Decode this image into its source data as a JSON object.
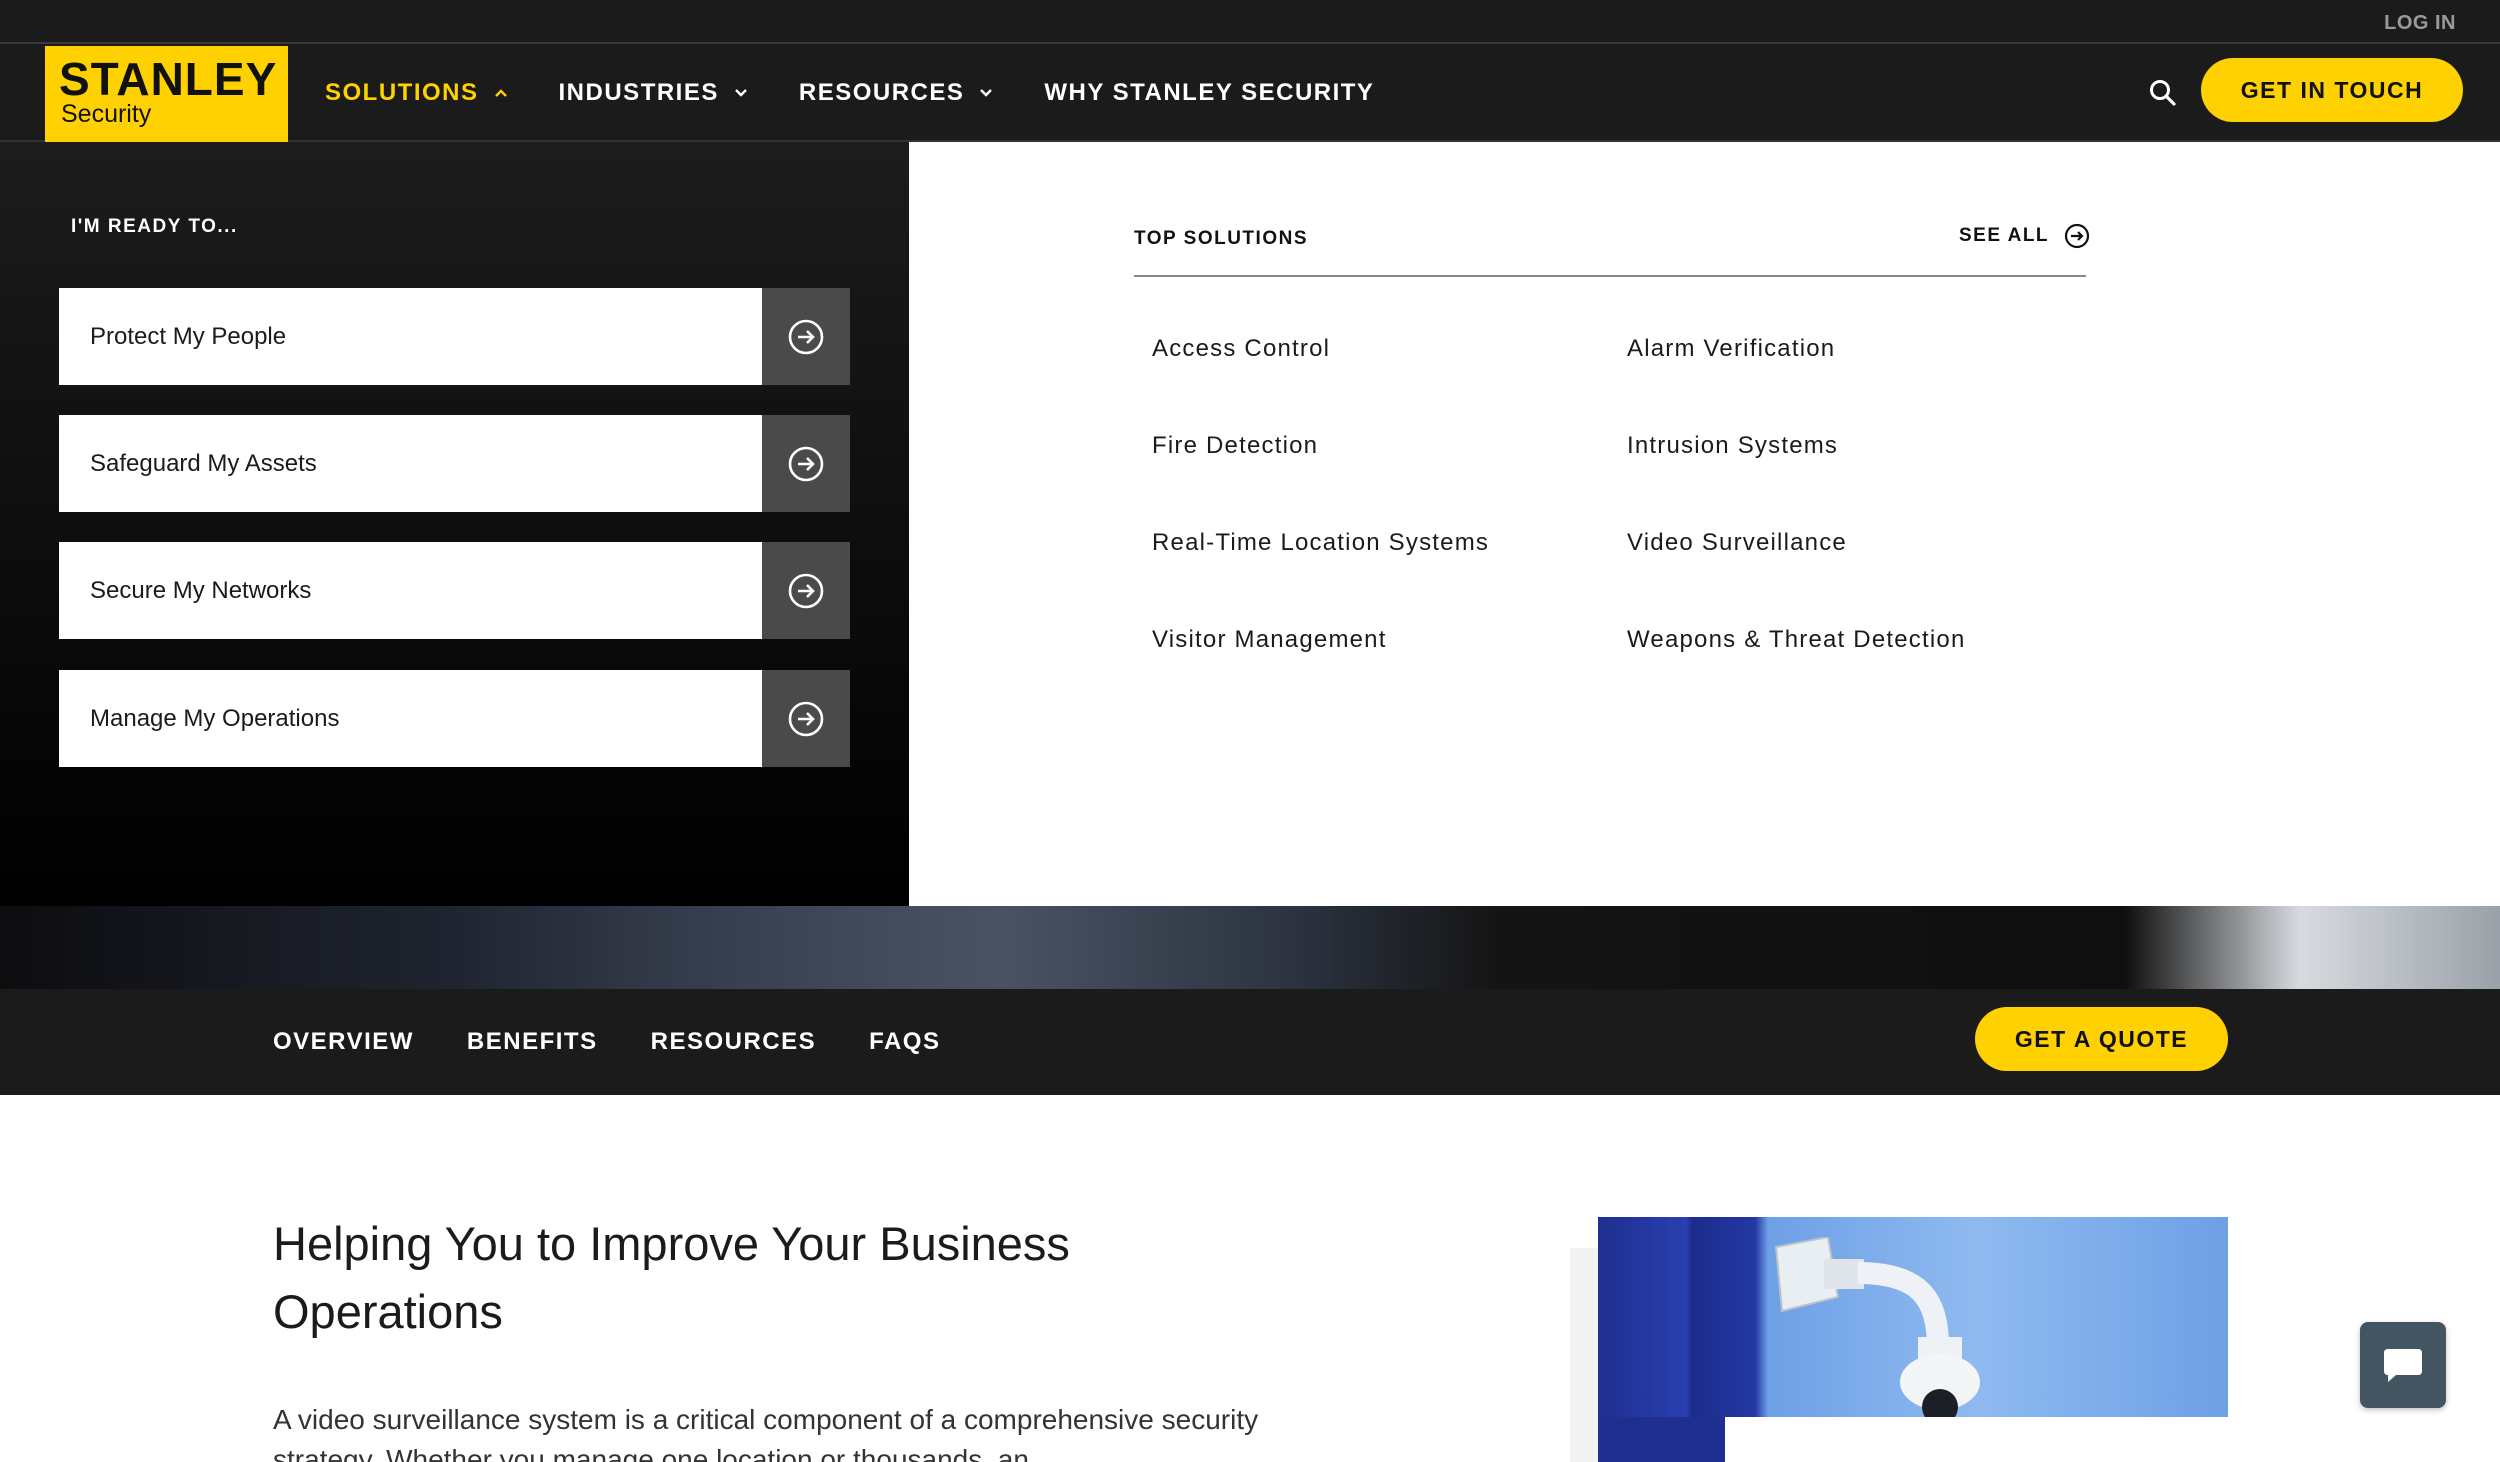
{
  "utility": {
    "login": "LOG IN"
  },
  "brand": {
    "name": "STANLEY",
    "sub": "Security",
    "accent": "#ffd100"
  },
  "nav": {
    "items": [
      {
        "label": "SOLUTIONS",
        "icon": "chevron-up-icon"
      },
      {
        "label": "INDUSTRIES",
        "icon": "chevron-down-icon"
      },
      {
        "label": "RESOURCES",
        "icon": "chevron-down-icon"
      },
      {
        "label": "WHY STANLEY SECURITY"
      }
    ],
    "search_icon": "search-icon",
    "cta": "GET IN TOUCH"
  },
  "mega": {
    "ready_title": "I'M READY TO...",
    "intents": [
      {
        "label": "Protect My People"
      },
      {
        "label": "Safeguard My Assets"
      },
      {
        "label": "Secure My Networks"
      },
      {
        "label": "Manage My Operations"
      }
    ],
    "top_title": "TOP SOLUTIONS",
    "see_all": "SEE ALL",
    "solutions": [
      "Access Control",
      "Alarm Verification",
      "Fire Detection",
      "Intrusion Systems",
      "Real-Time Location Systems",
      "Video Surveillance",
      "Visitor Management",
      "Weapons & Threat Detection"
    ]
  },
  "subnav": {
    "items": [
      "OVERVIEW",
      "BENEFITS",
      "RESOURCES",
      "FAQS"
    ],
    "cta": "GET A QUOTE"
  },
  "content": {
    "heading": "Helping You to Improve Your Business Operations",
    "body": "A video surveillance system is a critical component of a comprehensive security strategy. Whether you manage one location or thousands, an"
  },
  "chat": {
    "icon": "chat-bubble-icon"
  }
}
